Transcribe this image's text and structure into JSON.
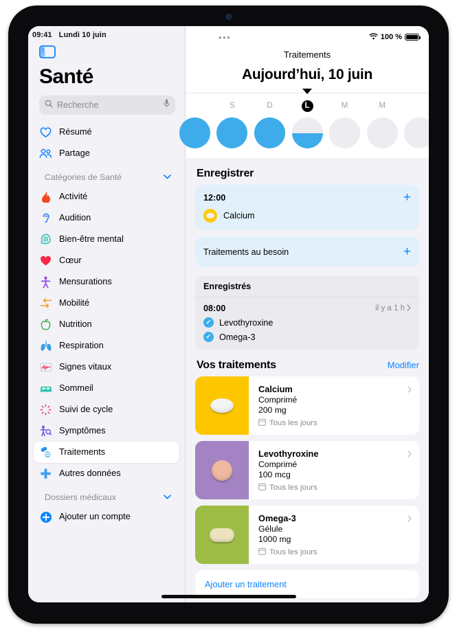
{
  "statusbar": {
    "time": "09:41",
    "date": "Lundi 10 juin",
    "dots": "•••",
    "battery_text": "100 %",
    "wifi_icon": "wifi-icon",
    "battery_icon": "battery-full-icon"
  },
  "sidebar": {
    "toggle_icon": "sidebar-toggle-icon",
    "title": "Santé",
    "search": {
      "placeholder": "Recherche",
      "search_icon": "search-icon",
      "mic_icon": "microphone-icon"
    },
    "top_items": [
      {
        "label": "Résumé",
        "icon": "heart-outline-icon",
        "color": "#0a84ff"
      },
      {
        "label": "Partage",
        "icon": "people-icon",
        "color": "#0a84ff"
      }
    ],
    "categories_header": {
      "label": "Catégories de Santé",
      "chevron": "chevron-down-icon"
    },
    "categories": [
      {
        "label": "Activité",
        "icon": "flame-icon",
        "color": "#f5461e"
      },
      {
        "label": "Audition",
        "icon": "ear-icon",
        "color": "#2a7ef0"
      },
      {
        "label": "Bien-être mental",
        "icon": "head-brain-icon",
        "color": "#19bdb4"
      },
      {
        "label": "Cœur",
        "icon": "heart-filled-icon",
        "color": "#f8294a"
      },
      {
        "label": "Mensurations",
        "icon": "body-icon",
        "color": "#9747e8"
      },
      {
        "label": "Mobilité",
        "icon": "arrows-icon",
        "color": "#f4a01c"
      },
      {
        "label": "Nutrition",
        "icon": "apple-icon",
        "color": "#2fb24b"
      },
      {
        "label": "Respiration",
        "icon": "lungs-icon",
        "color": "#35a0e8"
      },
      {
        "label": "Signes vitaux",
        "icon": "vitals-icon",
        "color": "#f2365e"
      },
      {
        "label": "Sommeil",
        "icon": "bed-icon",
        "color": "#2ec4b0"
      },
      {
        "label": "Suivi de cycle",
        "icon": "cycle-icon",
        "color": "#f2365e"
      },
      {
        "label": "Symptômes",
        "icon": "symptoms-icon",
        "color": "#6c4ae0"
      },
      {
        "label": "Traitements",
        "icon": "pills-icon",
        "color": "#2a94e8",
        "selected": true
      },
      {
        "label": "Autres données",
        "icon": "plus-cross-icon",
        "color": "#2a94e8"
      }
    ],
    "records_header": {
      "label": "Dossiers médicaux",
      "chevron": "chevron-down-icon"
    },
    "add_account": {
      "label": "Ajouter un compte",
      "icon": "plus-circle-icon",
      "color": "#0a84ff"
    }
  },
  "main": {
    "nav_title": "Traitements",
    "big_date": "Aujourd’hui, 10 juin",
    "days": [
      {
        "label": "",
        "progress": 100,
        "today": false,
        "edge": true
      },
      {
        "label": "S",
        "progress": 100,
        "today": false
      },
      {
        "label": "D",
        "progress": 100,
        "today": false
      },
      {
        "label": "L",
        "progress": 50,
        "today": true
      },
      {
        "label": "M",
        "progress": 0,
        "today": false
      },
      {
        "label": "M",
        "progress": 0,
        "today": false
      },
      {
        "label": "",
        "progress": 0,
        "today": false,
        "edge": true
      }
    ],
    "log_section": {
      "title": "Enregistrer",
      "scheduled": {
        "time": "12:00",
        "add_label": "+",
        "medication": "Calcium"
      },
      "as_needed": {
        "label": "Traitements au besoin",
        "add_label": "+"
      }
    },
    "logged_section": {
      "title": "Enregistrés",
      "time": "08:00",
      "ago": "il y a 1 h",
      "chevron": "chevron-right-icon",
      "items": [
        "Levothyroxine",
        "Omega-3"
      ]
    },
    "meds_section": {
      "title": "Vos traitements",
      "edit_label": "Modifier",
      "items": [
        {
          "name": "Calcium",
          "form": "Comprimé",
          "dose": "200 mg",
          "frequency": "Tous les jours",
          "thumb_color": "#fdc700",
          "pill_shape": "oval",
          "pill_color": "#f4f4f4",
          "calendar_icon": "calendar-icon",
          "chevron": "chevron-right-icon"
        },
        {
          "name": "Levothyroxine",
          "form": "Comprimé",
          "dose": "100 mcg",
          "frequency": "Tous les jours",
          "thumb_color": "#a383c4",
          "pill_shape": "round",
          "pill_color": "#f0b9a0",
          "calendar_icon": "calendar-icon",
          "chevron": "chevron-right-icon"
        },
        {
          "name": "Omega-3",
          "form": "Gélule",
          "dose": "1000 mg",
          "frequency": "Tous les jours",
          "thumb_color": "#9cbc45",
          "pill_shape": "capsule",
          "pill_color": "#ece3be",
          "calendar_icon": "calendar-icon",
          "chevron": "chevron-right-icon"
        }
      ],
      "add_label": "Ajouter un traitement"
    }
  },
  "colors": {
    "accent_blue": "#0a84ff",
    "ring_blue": "#3eaceb",
    "card_blue_bg": "#e2f0fb",
    "page_bg": "#f2f2f7"
  }
}
